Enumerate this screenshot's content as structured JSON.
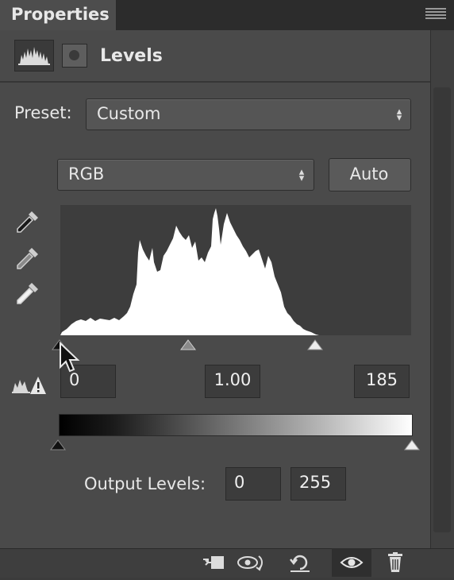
{
  "panel": {
    "tab_title": "Properties",
    "header_title": "Levels"
  },
  "preset": {
    "label": "Preset:",
    "value": "Custom"
  },
  "channel": {
    "value": "RGB"
  },
  "auto_label": "Auto",
  "input_levels": {
    "black": "0",
    "gamma": "1.00",
    "white": "185"
  },
  "output_levels": {
    "label": "Output Levels:",
    "black": "0",
    "white": "255"
  },
  "icons": {
    "levels": "histogram-icon",
    "mask": "mask-icon",
    "eyedropper_black": "eyedropper-icon",
    "eyedropper_gray": "eyedropper-icon",
    "eyedropper_white": "eyedropper-icon",
    "clip_warning": "clipping-warning-icon",
    "clip_to_layer": "clip-to-layer-icon",
    "view_previous": "view-previous-icon",
    "reset": "reset-icon",
    "visibility": "eye-icon",
    "delete": "trash-icon",
    "panel_menu": "panel-menu-icon"
  },
  "colors": {
    "panel_bg": "#4a4a4a",
    "histogram_fill": "#ffffff",
    "histogram_bg": "#3d3d3d"
  }
}
